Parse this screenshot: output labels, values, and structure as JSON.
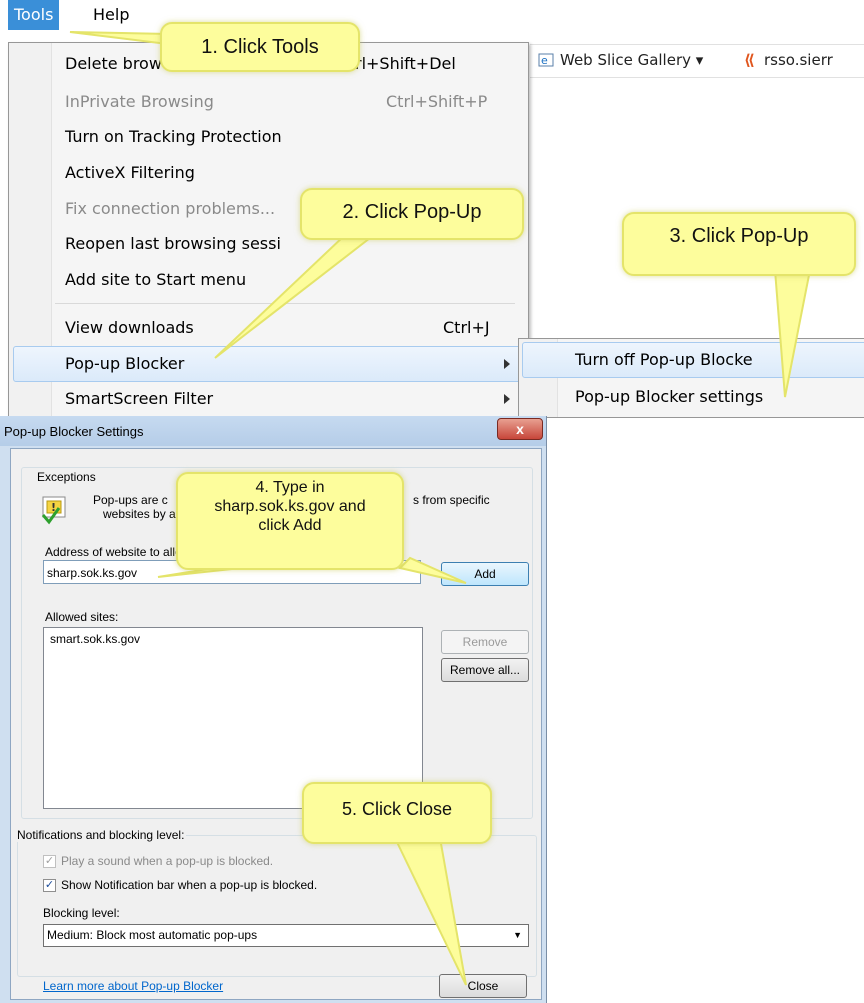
{
  "menubar": {
    "tools": "Tools",
    "help": "Help"
  },
  "favorites_bar": {
    "item1": "Web Slice Gallery ▾",
    "item2": "rsso.sierr"
  },
  "tools_menu": {
    "items": [
      {
        "label": "Delete brow",
        "shortcut": "rl+Shift+Del",
        "disabled": false
      },
      {
        "label": "InPrivate Browsing",
        "shortcut": "Ctrl+Shift+P",
        "disabled": true
      },
      {
        "label": "Turn on Tracking Protection",
        "shortcut": "",
        "disabled": false
      },
      {
        "label": "ActiveX Filtering",
        "shortcut": "",
        "disabled": false
      },
      {
        "label": "Fix connection problems...",
        "shortcut": "",
        "disabled": true
      },
      {
        "label": "Reopen last browsing sessi",
        "shortcut": "",
        "disabled": false
      },
      {
        "label": "Add site to Start menu",
        "shortcut": "",
        "disabled": false
      },
      {
        "label": "View downloads",
        "shortcut": "Ctrl+J",
        "disabled": false
      },
      {
        "label": "Pop-up Blocker",
        "shortcut": "",
        "disabled": false,
        "highlighted": true
      },
      {
        "label": "SmartScreen Filter",
        "shortcut": "",
        "disabled": false
      }
    ]
  },
  "submenu": {
    "item1": "Turn off Pop-up Blocke",
    "item2": "Pop-up Blocker settings"
  },
  "dialog": {
    "title": "Pop-up Blocker Settings",
    "close_glyph": "x",
    "exceptions_label": "Exceptions",
    "exceptions_text_a": "Pop-ups are c",
    "exceptions_text_b": "s from specific",
    "exceptions_text_c": "websites by a",
    "address_label": "Address of website to allow:",
    "address_value": "sharp.sok.ks.gov",
    "add_button": "Add",
    "allowed_label": "Allowed sites:",
    "allowed_sites": [
      "smart.sok.ks.gov"
    ],
    "remove_button": "Remove",
    "remove_all_button": "Remove all...",
    "notifications_label": "Notifications and blocking level:",
    "play_sound": "Play a sound when a pop-up is blocked.",
    "show_bar": "Show Notification bar when a pop-up is blocked.",
    "blocking_label": "Blocking level:",
    "blocking_value": "Medium: Block most automatic pop-ups",
    "learn_more": "Learn more about Pop-up Blocker",
    "close_button": "Close"
  },
  "callouts": {
    "c1": "1. Click Tools",
    "c2": "2. Click Pop-Up",
    "c3": "3. Click Pop-Up",
    "c4_line1": "4. Type in",
    "c4_line2": "sharp.sok.ks.gov and",
    "c4_line3": "click Add",
    "c5": "5. Click Close"
  },
  "colors": {
    "callout": "#fdfd9c",
    "tools_highlight": "#3a8fd8",
    "link": "#0066cc"
  }
}
